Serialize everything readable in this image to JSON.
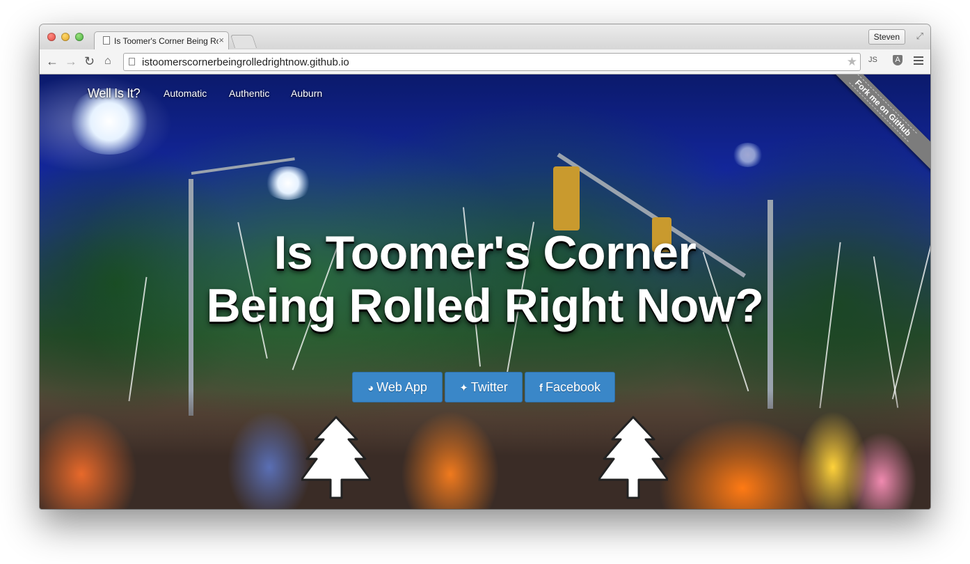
{
  "browser": {
    "tab_title": "Is Toomer's Corner Being Rolled Right Now?",
    "tab_close": "×",
    "profile_name": "Steven",
    "address": "istoomerscornerbeingrolledrightnow.github.io",
    "ext1": "JS",
    "ext2": "A"
  },
  "nav": {
    "brand": "Well Is It?",
    "links": [
      "Automatic",
      "Authentic",
      "Auburn"
    ]
  },
  "ribbon": {
    "label": "Fork me on GitHub"
  },
  "hero": {
    "line1": "Is Toomer's Corner",
    "line2": "Being Rolled Right Now?"
  },
  "buttons": [
    {
      "label": "Web App",
      "icon": "globe-icon"
    },
    {
      "label": "Twitter",
      "icon": "twitter-icon"
    },
    {
      "label": "Facebook",
      "icon": "facebook-icon"
    }
  ],
  "colors": {
    "button_bg": "#3a87c8",
    "ribbon_bg": "#7c7c7c",
    "sky": "#13269a"
  }
}
